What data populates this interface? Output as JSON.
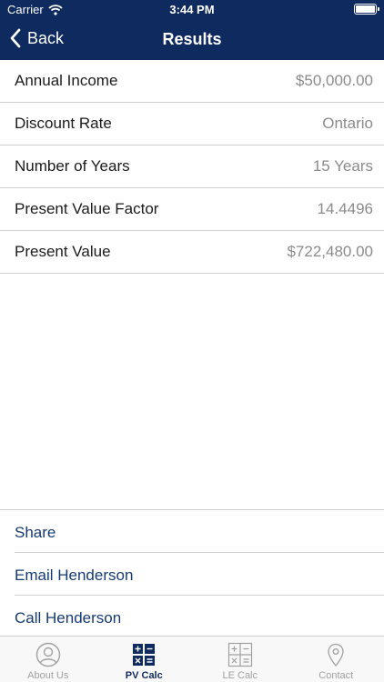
{
  "status_bar": {
    "carrier": "Carrier",
    "time": "3:44 PM"
  },
  "nav": {
    "back_label": "Back",
    "title": "Results"
  },
  "results": [
    {
      "label": "Annual Income",
      "value": "$50,000.00"
    },
    {
      "label": "Discount Rate",
      "value": "Ontario"
    },
    {
      "label": "Number of Years",
      "value": "15 Years"
    },
    {
      "label": "Present Value Factor",
      "value": "14.4496"
    },
    {
      "label": "Present Value",
      "value": "$722,480.00"
    }
  ],
  "actions": [
    {
      "label": "Share"
    },
    {
      "label": "Email Henderson"
    },
    {
      "label": "Call Henderson"
    }
  ],
  "tabs": [
    {
      "label": "About Us",
      "icon": "person-circle-icon",
      "active": false
    },
    {
      "label": "PV Calc",
      "icon": "calculator-icon",
      "active": true
    },
    {
      "label": "LE Calc",
      "icon": "calculator-outline-icon",
      "active": false
    },
    {
      "label": "Contact",
      "icon": "location-pin-icon",
      "active": false
    }
  ],
  "colors": {
    "header": "#0f2a5e",
    "link": "#153a73",
    "value_gray": "#8b8b8b",
    "tab_inactive": "#a0a0a0"
  }
}
